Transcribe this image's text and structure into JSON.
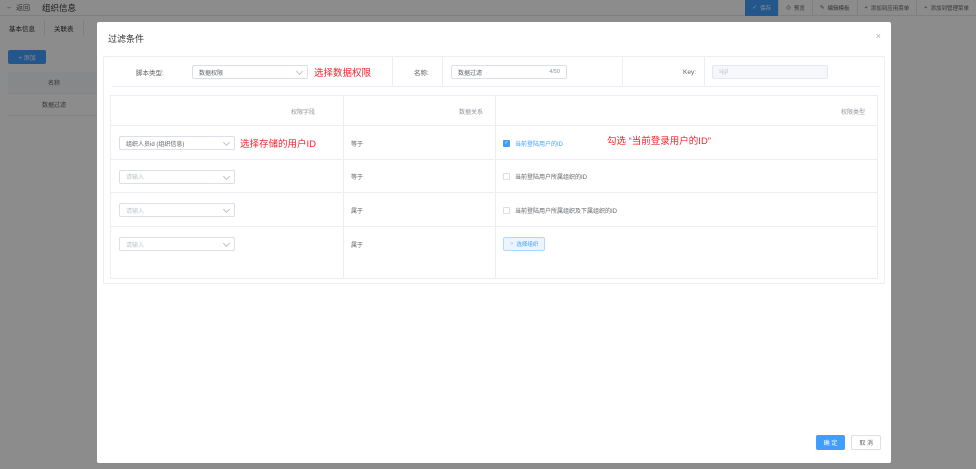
{
  "background": {
    "back_label": "返回",
    "page_title": "组织信息",
    "actions": [
      {
        "icon": "check-icon",
        "label": "保存"
      },
      {
        "icon": "eye-icon",
        "label": "预览"
      },
      {
        "icon": "pencil-icon",
        "label": "编辑模板"
      },
      {
        "icon": "plus-icon",
        "label": "添加到应用菜单"
      },
      {
        "icon": "plus-icon",
        "label": "添加到管理菜单"
      }
    ],
    "tabs": [
      "基本信息",
      "关联表"
    ],
    "add_label": "+ 添加",
    "table": {
      "header": "名称",
      "rows": [
        "数据过滤"
      ]
    }
  },
  "dialog": {
    "title": "过滤条件",
    "close_glyph": "×",
    "form": {
      "script_type_label": "脚本类型:",
      "script_type_value": "数据权限",
      "script_type_annotation": "选择数据权限",
      "name_label": "名称:",
      "name_value": "数据过滤",
      "name_count": "4/50",
      "key_label": "Key:",
      "key_value": "sjgl"
    },
    "table": {
      "headers": {
        "field": "权限字段",
        "relation": "数据关系",
        "type": "权限类型"
      },
      "rows": [
        {
          "field": "组织人员id (组织信息)",
          "field_placeholder": false,
          "field_annotation": "选择存储的用户ID",
          "relation": "等于",
          "type_kind": "checkbox",
          "type_label": "当前登陆用户的ID",
          "checked": true,
          "type_annotation": "勾选 “当前登录用户的ID”"
        },
        {
          "field": "请输入",
          "field_placeholder": true,
          "relation": "等于",
          "type_kind": "checkbox",
          "type_label": "当前登陆用户所属组织的ID",
          "checked": false
        },
        {
          "field": "请输入",
          "field_placeholder": true,
          "relation": "属于",
          "type_kind": "checkbox",
          "type_label": "当前登陆用户所属组织及下属组织的ID",
          "checked": false
        },
        {
          "field": "请输入",
          "field_placeholder": true,
          "relation": "属于",
          "type_kind": "button",
          "type_label": "选择组织",
          "checked": false
        }
      ]
    },
    "footer": {
      "confirm": "确 定",
      "cancel": "取 消"
    }
  },
  "colors": {
    "primary": "#409eff",
    "annotation": "#f5222d",
    "overlay": "rgba(0,0,0,0.45)"
  }
}
